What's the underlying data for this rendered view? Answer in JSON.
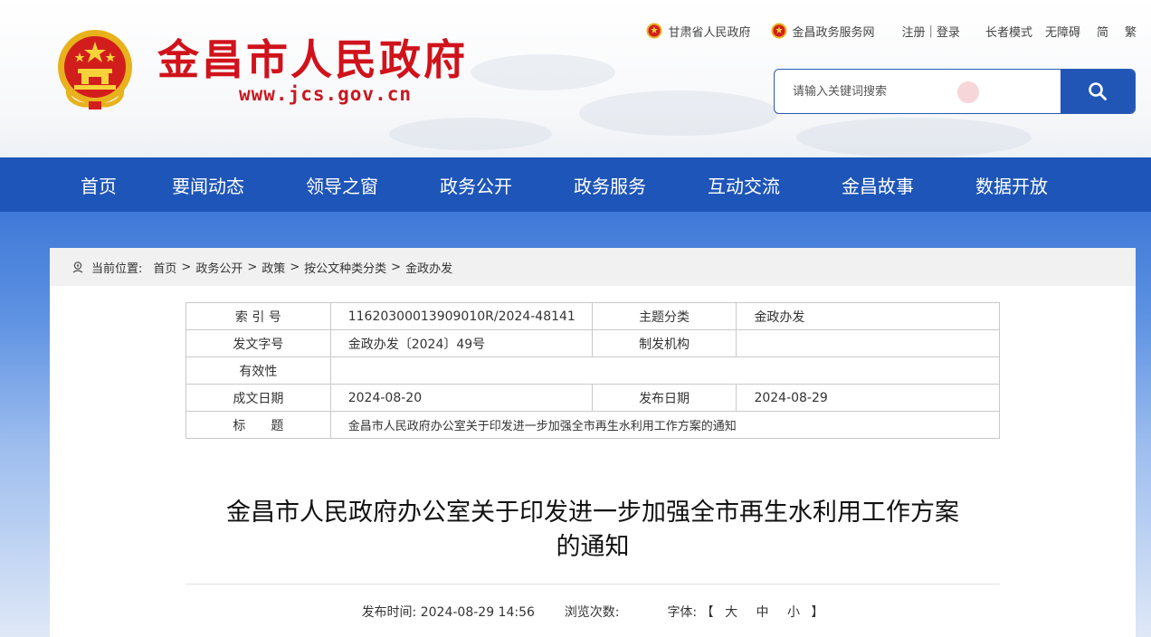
{
  "header": {
    "site_title": "金昌市人民政府",
    "site_url": "www.jcs.gov.cn",
    "top_links": {
      "provincial_gov": "甘肃省人民政府",
      "service_net": "金昌政务服务网",
      "register": "注册",
      "separator": "|",
      "login": "登录",
      "elder_mode": "长者模式",
      "accessibility": "无障碍",
      "simplified": "简",
      "traditional": "繁"
    },
    "search": {
      "placeholder": "请输入关键词搜索"
    }
  },
  "nav": {
    "items": [
      "首页",
      "要闻动态",
      "领导之窗",
      "政务公开",
      "政务服务",
      "互动交流",
      "金昌故事",
      "数据开放"
    ]
  },
  "breadcrumb": {
    "prefix": "当前位置:",
    "items": [
      "首页",
      "政务公开",
      "政策",
      "按公文种类分类",
      "金政办发"
    ],
    "arrow": ">"
  },
  "meta": {
    "index_label": "索 引 号",
    "index_value": "11620300013909010R/2024-48141",
    "topic_label": "主题分类",
    "topic_value": "金政办发",
    "doc_no_label": "发文字号",
    "doc_no_value": "金政办发〔2024〕49号",
    "issuer_label": "制发机构",
    "issuer_value": "",
    "validity_label": "有效性",
    "validity_value": "",
    "written_label": "成文日期",
    "written_value": "2024-08-20",
    "publish_label": "发布日期",
    "publish_value": "2024-08-29",
    "title_label": "标　　题",
    "title_value": "金昌市人民政府办公室关于印发进一步加强全市再生水利用工作方案的通知"
  },
  "article": {
    "title_line1": "金昌市人民政府办公室关于印发进一步加强全市再生水利用工作方案",
    "title_line2": "的通知",
    "publish_time_label": "发布时间:",
    "publish_time": "2024-08-29 14:56",
    "views_label": "浏览次数:",
    "font_label": "字体:",
    "bracket_open": "【",
    "font_large": "大",
    "font_medium": "中",
    "font_small": "小",
    "bracket_close": "】"
  },
  "colors": {
    "brand_red": "#d0121b",
    "nav_blue": "#1e55b8",
    "search_blue": "#2256b6"
  },
  "icons": [
    "national-emblem-icon",
    "search-icon",
    "location-pin-icon"
  ]
}
